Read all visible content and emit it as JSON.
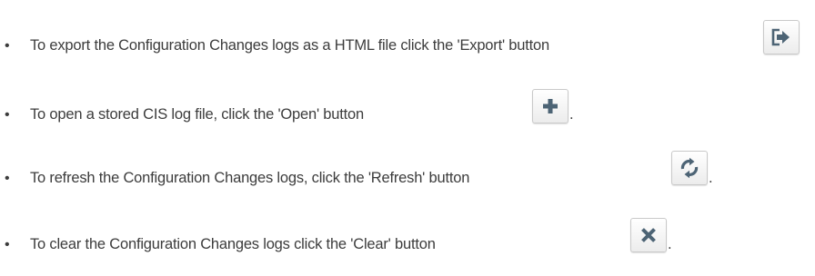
{
  "instructions": {
    "bullet": "•",
    "items": [
      {
        "text": "To export the Configuration Changes logs as a HTML file click the 'Export' button",
        "trailing": "",
        "icon": "export-icon"
      },
      {
        "text": "To open a stored CIS log file, click the 'Open' button",
        "trailing": ".",
        "icon": "plus-icon"
      },
      {
        "text": "To refresh the Configuration Changes logs, click the 'Refresh' button",
        "trailing": ".",
        "icon": "refresh-icon"
      },
      {
        "text": "To clear the Configuration Changes logs click the 'Clear' button",
        "trailing": ".",
        "icon": "close-icon"
      }
    ]
  },
  "colors": {
    "text": "#3c3c3c",
    "icon": "#4d6475",
    "button_border": "#c9c9c9"
  }
}
